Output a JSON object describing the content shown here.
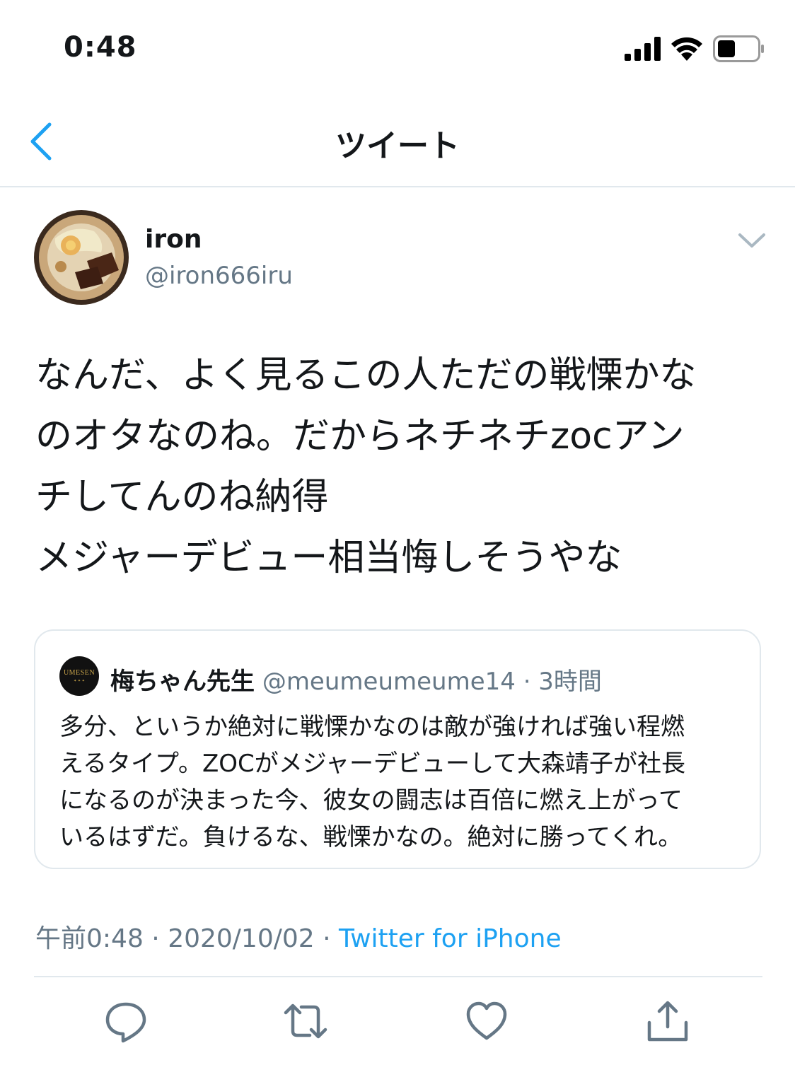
{
  "status_bar": {
    "time": "0:48"
  },
  "nav": {
    "title": "ツイート",
    "back_icon": "chevron-left-icon"
  },
  "tweet": {
    "author": {
      "display_name": "iron",
      "handle": "@iron666iru"
    },
    "text_lines": [
      "なんだ、よく見るこの人ただの戦慄かな",
      "のオタなのね。だからネチネチzocアン",
      "チしてんのね納得",
      "メジャーデビュー相当悔しそうやな"
    ],
    "quoted": {
      "display_name": "梅ちゃん先生",
      "handle": "@meumeumeume14",
      "time_ago": "· 3時間",
      "avatar_logo": "UMESEN",
      "text_lines": [
        "多分、というか絶対に戦慄かなのは敵が強ければ強い程燃",
        "えるタイプ。ZOCがメジャーデビューして大森靖子が社長",
        "になるのが決まった今、彼女の闘志は百倍に燃え上がって",
        "いるはずだ。負けるな、戦慄かなの。絶対に勝ってくれ。"
      ]
    },
    "meta": {
      "time": "午前0:48",
      "sep1": " · ",
      "date": "2020/10/02",
      "sep2": " · ",
      "source": "Twitter for iPhone"
    }
  },
  "actions": [
    {
      "icon": "reply-icon"
    },
    {
      "icon": "retweet-icon"
    },
    {
      "icon": "like-icon"
    },
    {
      "icon": "share-icon"
    }
  ],
  "colors": {
    "accent": "#1da1f2",
    "secondary_text": "#657786",
    "border": "#e1e8ed",
    "text": "#14171a"
  }
}
